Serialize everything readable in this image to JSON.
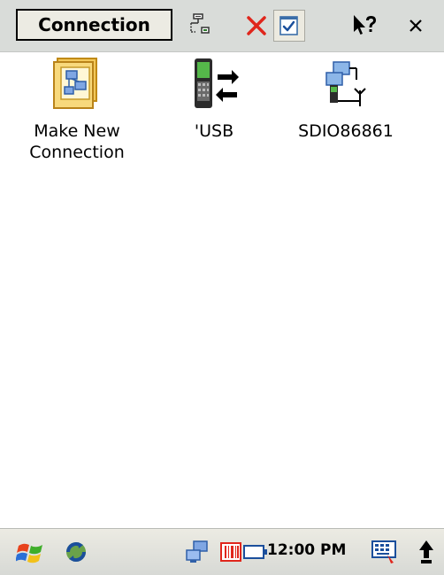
{
  "toolbar": {
    "title": "Connection",
    "icons": [
      "network-properties-icon",
      "delete-icon",
      "properties-checkbox-icon",
      "help-icon",
      "close-icon"
    ],
    "close_glyph": "×"
  },
  "items": [
    {
      "label": "Make New Connection",
      "icon": "make-new-connection-icon"
    },
    {
      "label": "'USB",
      "icon": "usb-sync-icon"
    },
    {
      "label": "SDIO86861",
      "icon": "wireless-adapter-icon"
    }
  ],
  "taskbar": {
    "time": "12:00 PM",
    "icons": [
      "start-flag-icon",
      "activesync-icon",
      "network-tray-icon",
      "barcode-scanner-icon",
      "battery-icon",
      "keyboard-icon",
      "up-arrow-icon"
    ]
  }
}
